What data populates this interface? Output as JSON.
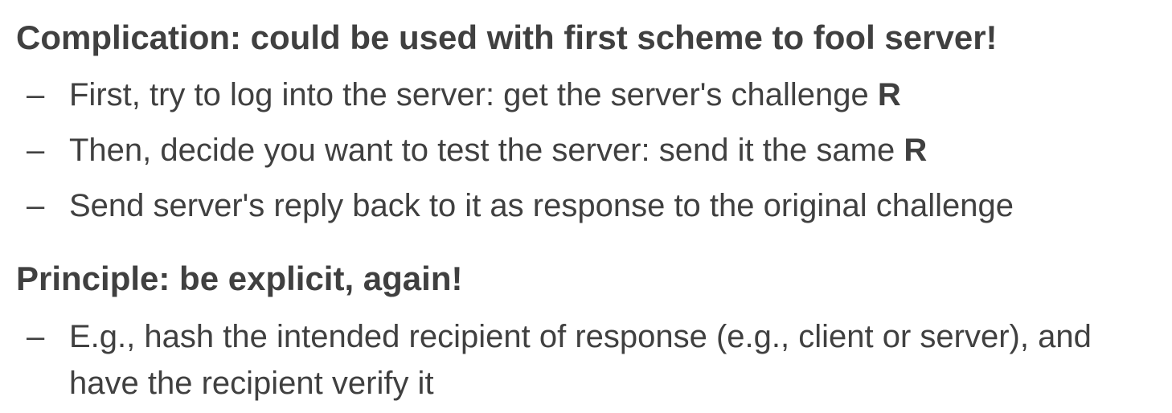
{
  "sections": [
    {
      "heading": "Complication: could be used with first scheme to fool server!",
      "bullets": [
        {
          "dash": "–",
          "text": "First, try to log into the server: get the server's challenge ",
          "bold": "R"
        },
        {
          "dash": "–",
          "text": "Then, decide you want to test the server: send it the same ",
          "bold": "R"
        },
        {
          "dash": "–",
          "text": "Send server's reply back to it as response to the original challenge"
        }
      ]
    },
    {
      "heading": "Principle: be explicit, again!",
      "bullets": [
        {
          "dash": "–",
          "line1": "E.g., hash the intended recipient of response (e.g., client or server), and",
          "line2": "have the recipient verify it"
        }
      ]
    }
  ]
}
